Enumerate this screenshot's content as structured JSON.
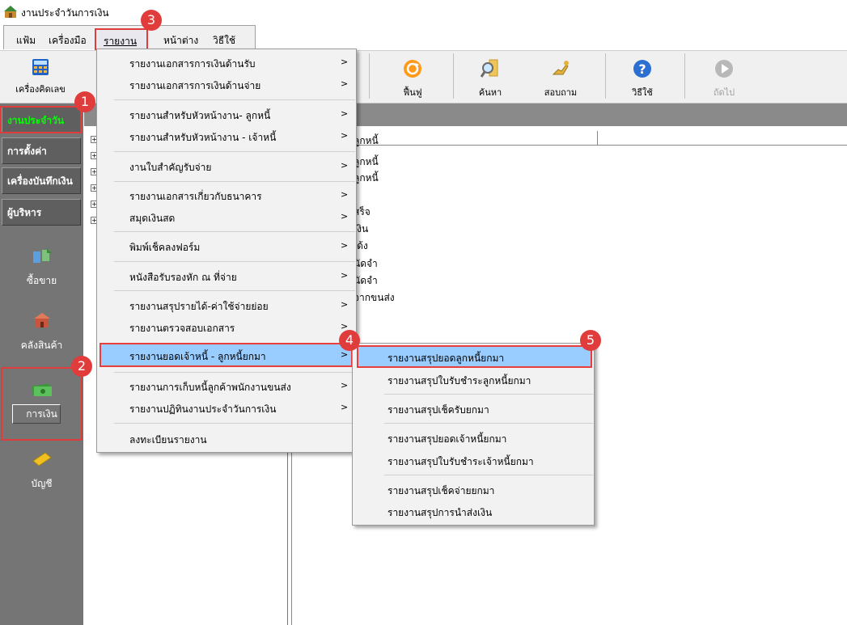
{
  "window": {
    "title": "งานประจำวันการเงิน"
  },
  "menubar": {
    "items": [
      "แฟ้ม",
      "เครื่องมือ",
      "รายงาน",
      "หน้าต่าง",
      "วิธีใช้"
    ]
  },
  "toolbar": {
    "calculator": "เครื่องคิดเลข",
    "refresh": "ฟื้นฟู",
    "search": "ค้นหา",
    "inquiry": "สอบถาม",
    "help": "วิธีใช้",
    "next": "ถัดไป"
  },
  "leftnav": {
    "buttons": [
      "งานประจำวัน",
      "การตั้งค่า",
      "เครื่องบันทึกเงิน",
      "ผู้บริหาร"
    ],
    "modules": [
      "ซื้อขาย",
      "คลังสินค้า",
      "การเงิน",
      "บัญชี"
    ]
  },
  "list": {
    "header": "ลูกหนี้",
    "rows": [
      "ลูกหนี้",
      "ลูกหนี้",
      "สร็จ",
      "เงิน",
      "เด้ง",
      "นัดจำ",
      "นัดจำ",
      "จากขนส่ง"
    ]
  },
  "dropdown": {
    "items": [
      "รายงานเอกสารการเงินด้านรับ",
      "รายงานเอกสารการเงินด้านจ่าย",
      "รายงานสำหรับหัวหน้างาน- ลูกหนี้",
      "รายงานสำหรับหัวหน้างาน - เจ้าหนี้",
      "งานใบสำคัญรับจ่าย",
      "รายงานเอกสารเกี่ยวกับธนาคาร",
      "สมุดเงินสด",
      "พิมพ์เช็คลงฟอร์ม",
      "หนังสือรับรองหัก ณ ที่จ่าย",
      "รายงานสรุปรายได้-ค่าใช้จ่ายย่อย",
      "รายงานตรวจสอบเอกสาร",
      "รายงานยอดเจ้าหนี้  - ลูกหนี้ยกมา",
      "รายงานการเก็บหนี้ลูกค้าพนักงานขนส่ง",
      "รายงานปฏิทินงานประจำวันการเงิน",
      "ลงทะเบียนรายงาน"
    ]
  },
  "submenu": {
    "items": [
      "รายงานสรุปยอดลูกหนี้ยกมา",
      "รายงานสรุปใบรับชำระลูกหนี้ยกมา",
      "รายงานสรุปเช็ครับยกมา",
      "รายงานสรุปยอดเจ้าหนี้ยกมา",
      "รายงานสรุปใบรับชำระเจ้าหนี้ยกมา",
      "รายงานสรุปเช็คจ่ายยกมา",
      "รายงานสรุปการนำส่งเงิน"
    ]
  },
  "callouts": [
    "1",
    "2",
    "3",
    "4",
    "5"
  ],
  "colors": {
    "highlight": "#99ccff",
    "callout": "#e03c3c",
    "active_nav": "#00ff00",
    "nav_bg": "#757575"
  }
}
